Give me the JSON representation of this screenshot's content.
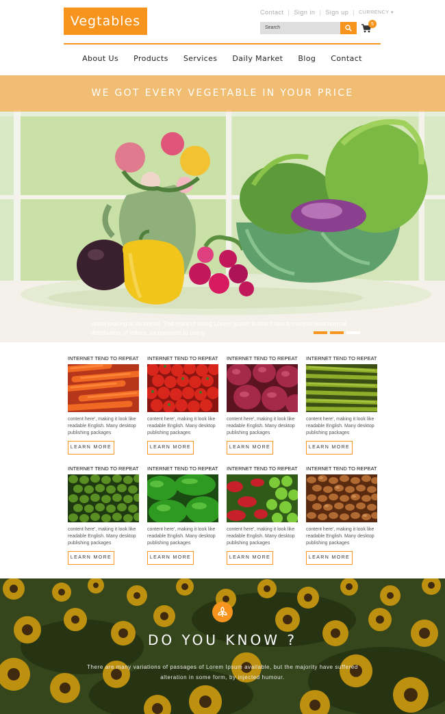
{
  "brand": {
    "logo_text": "Vegtables",
    "accent_color": "#f7941d"
  },
  "top_links": {
    "contact": "Contact",
    "sign_in": "Sign in",
    "sign_up": "Sign up",
    "currency": "CURRENCY"
  },
  "search": {
    "placeholder": "Search",
    "icon": "search-icon"
  },
  "cart": {
    "count": "5",
    "icon": "cart-icon"
  },
  "nav": {
    "items": [
      "About Us",
      "Products",
      "Services",
      "Daily Market",
      "Blog",
      "Contact"
    ]
  },
  "hero": {
    "title": "WE GOT EVERY VEGETABLE IN YOUR PRICE",
    "caption": "when looking at its layout. The point of using Lorem Ipsum is that it has a more-or-less normal distribution of letters, as opposed to using",
    "slides": 3,
    "active_slides": [
      0,
      1
    ]
  },
  "products": [
    {
      "title": "INTERNET TEND TO REPEAT",
      "text": "content here', making it look like readable English. Many desktop publishing packages",
      "button": "LEARN MORE",
      "image": "carrots"
    },
    {
      "title": "INTERNET TEND TO REPEAT",
      "text": "content here', making it look like readable English. Many desktop publishing packages",
      "button": "LEARN MORE",
      "image": "tomatoes"
    },
    {
      "title": "INTERNET TEND TO REPEAT",
      "text": "content here', making it look like readable English. Many desktop publishing packages",
      "button": "LEARN MORE",
      "image": "red-onions"
    },
    {
      "title": "INTERNET TEND TO REPEAT",
      "text": "content here', making it look like readable English. Many desktop publishing packages",
      "button": "LEARN MORE",
      "image": "green-beans"
    },
    {
      "title": "INTERNET TEND TO REPEAT",
      "text": "content here', making it look like readable English. Many desktop publishing packages",
      "button": "LEARN MORE",
      "image": "green-peas"
    },
    {
      "title": "INTERNET TEND TO REPEAT",
      "text": "content here', making it look like readable English. Many desktop publishing packages",
      "button": "LEARN MORE",
      "image": "green-peppers"
    },
    {
      "title": "INTERNET TEND TO REPEAT",
      "text": "content here', making it look like readable English. Many desktop publishing packages",
      "button": "LEARN MORE",
      "image": "chili-peppers"
    },
    {
      "title": "INTERNET TEND TO REPEAT",
      "text": "content here', making it look like readable English. Many desktop publishing packages",
      "button": "LEARN MORE",
      "image": "beans"
    }
  ],
  "know": {
    "title": "DO YOU KNOW ?",
    "text": "There are many variations of passages of Lorem Ipsum available, but the majority have suffered alteration in some form, by injected humour.",
    "icon": "leaf-icon"
  }
}
